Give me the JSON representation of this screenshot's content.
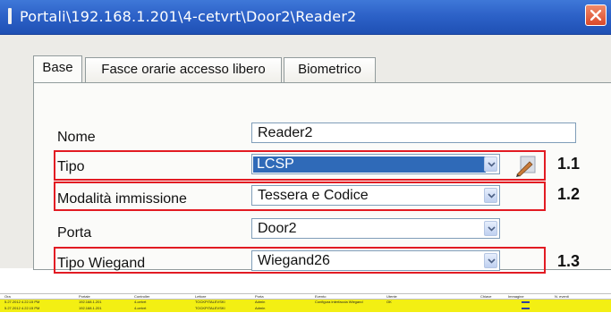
{
  "window": {
    "title": "Portali\\192.168.1.201\\4-cetvrt\\Door2\\Reader2"
  },
  "tabs": [
    {
      "label": "Base"
    },
    {
      "label": "Fasce orarie accesso libero"
    },
    {
      "label": "Biometrico"
    }
  ],
  "form": {
    "nome": {
      "label": "Nome",
      "value": "Reader2"
    },
    "tipo": {
      "label": "Tipo",
      "value": "LCSP"
    },
    "modalita": {
      "label": "Modalità immissione",
      "value": "Tessera e Codice"
    },
    "porta": {
      "label": "Porta",
      "value": "Door2"
    },
    "tipo_wiegand": {
      "label": "Tipo Wiegand",
      "value": "Wiegand26"
    }
  },
  "annotations": [
    "1.1",
    "1.2",
    "1.3"
  ],
  "colors": {
    "highlight_box": "#e21b23",
    "selection": "#2f6ab8",
    "title_bar": "#2d62c8",
    "row_highlight": "#f3ef13"
  },
  "icons": {
    "close": "close-icon",
    "dropdown": "chevron-down-icon",
    "edit": "edit-icon"
  },
  "log": {
    "columns": [
      "Ora",
      "Portale",
      "Controller",
      "Lettore",
      "Porta",
      "Evento",
      "Utente",
      "Chiave",
      "Immagine",
      "N. eventi"
    ],
    "rows": [
      [
        "5.27.2012 4.22.15 PM",
        "192.168.1.201",
        "4-cetvrt",
        "TOCKPITALEVSKI",
        "Admin",
        "Configura interfaccia Wiegand",
        "OK",
        "",
        "",
        ""
      ],
      [
        "5.27.2012 4.22.15 PM",
        "192.168.1.201",
        "4-cetvrt",
        "TOCKPITALEVSKI",
        "Admin",
        "",
        "",
        "",
        "",
        ""
      ]
    ]
  }
}
